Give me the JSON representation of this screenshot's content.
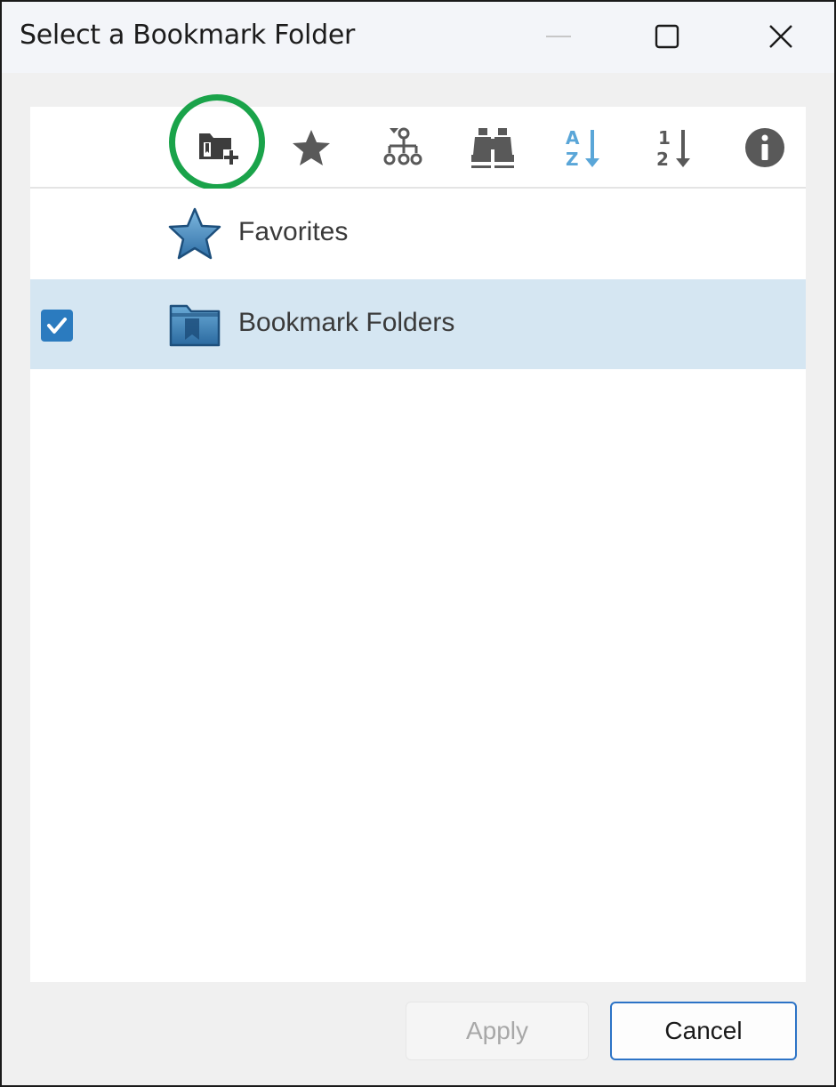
{
  "window": {
    "title": "Select a Bookmark Folder"
  },
  "toolbar": {
    "buttons": [
      {
        "icon": "new-folder-icon",
        "highlighted": true
      },
      {
        "icon": "star-icon"
      },
      {
        "icon": "hierarchy-icon"
      },
      {
        "icon": "binoculars-icon"
      },
      {
        "icon": "sort-alpha-icon",
        "active": true
      },
      {
        "icon": "sort-numeric-icon"
      },
      {
        "icon": "info-icon"
      }
    ],
    "sort_alpha_top": "A",
    "sort_alpha_bottom": "Z",
    "sort_num_top": "1",
    "sort_num_bottom": "2"
  },
  "tree": {
    "items": [
      {
        "label": "Favorites",
        "icon": "star-icon",
        "checked": false,
        "selected": false
      },
      {
        "label": "Bookmark Folders",
        "icon": "bookmark-folder-icon",
        "checked": true,
        "selected": true
      }
    ]
  },
  "footer": {
    "apply_label": "Apply",
    "apply_enabled": false,
    "cancel_label": "Cancel"
  },
  "colors": {
    "highlight_ring": "#1aa34a",
    "selection": "#d5e6f2",
    "accent": "#2b7bbf",
    "sort_active": "#5aa6d8"
  }
}
